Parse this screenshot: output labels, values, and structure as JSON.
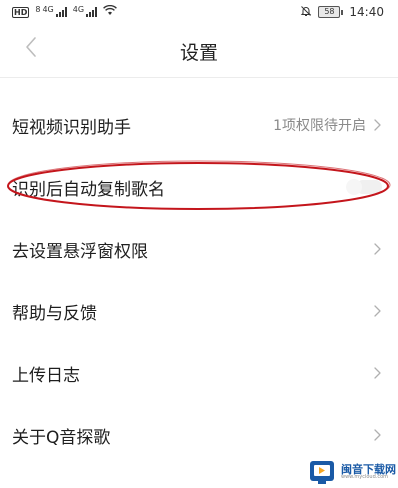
{
  "status_bar": {
    "hd_badge": "HD",
    "sim1_label": "8",
    "sim1_network": "4G",
    "sim2_network": "4G",
    "battery_level": "58",
    "time": "14:40"
  },
  "header": {
    "title": "设置",
    "back_icon": "chevron-left-icon"
  },
  "settings": {
    "items": [
      {
        "label": "短视频识别助手",
        "value": "1项权限待开启",
        "control": "chevron"
      },
      {
        "label": "识别后自动复制歌名",
        "control": "toggle",
        "toggle_on": false
      },
      {
        "label": "去设置悬浮窗权限",
        "control": "chevron"
      },
      {
        "label": "帮助与反馈",
        "control": "chevron"
      },
      {
        "label": "上传日志",
        "control": "chevron"
      },
      {
        "label": "关于Q音探歌",
        "control": "chevron"
      }
    ]
  },
  "annotation": {
    "color": "#c4161c",
    "target": "识别后自动复制歌名"
  },
  "watermark": {
    "text": "闽音下载网",
    "subtext": "www.mycloud.com"
  },
  "colors": {
    "background": "#ffffff",
    "divider": "#ececec",
    "secondary_text": "#8a8a8a",
    "annotation_red": "#c4161c"
  }
}
